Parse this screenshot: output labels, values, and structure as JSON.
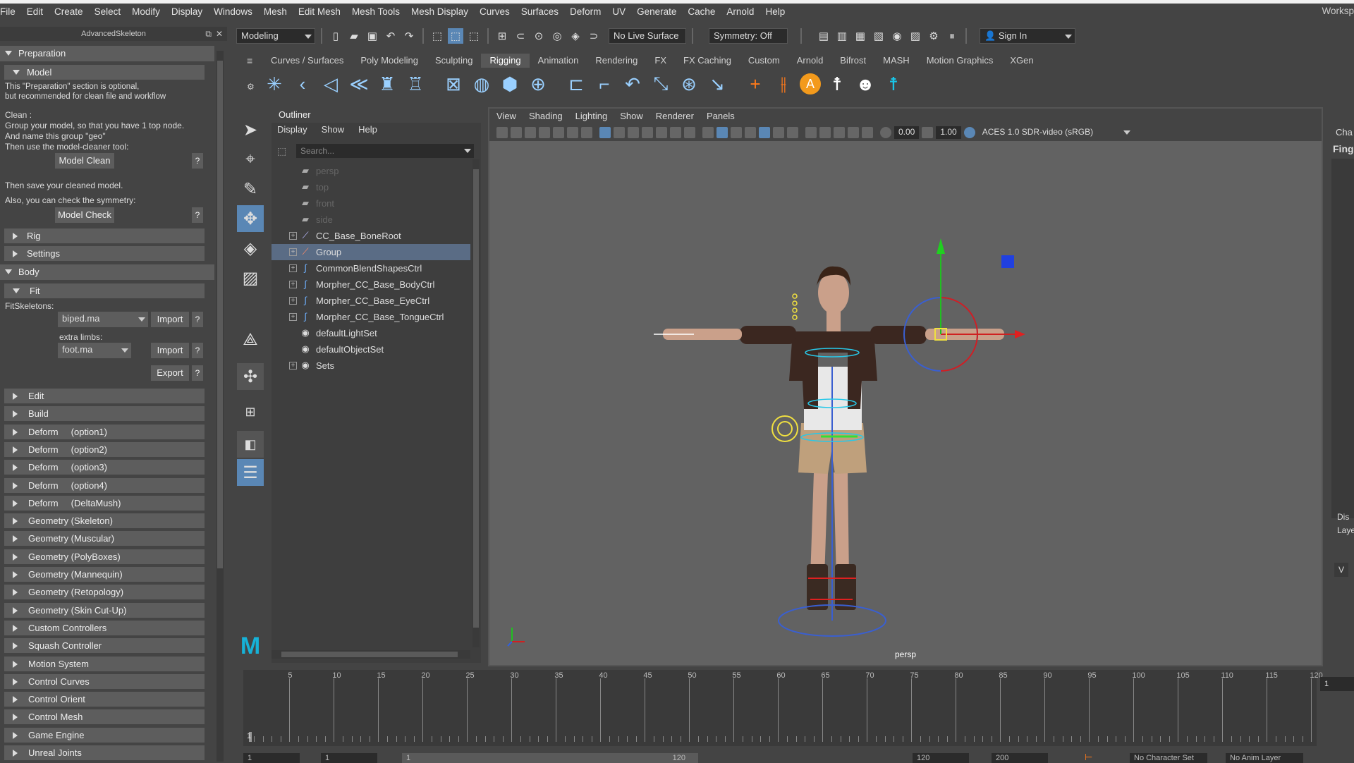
{
  "menu": [
    "File",
    "Edit",
    "Create",
    "Select",
    "Modify",
    "Display",
    "Windows",
    "Mesh",
    "Edit Mesh",
    "Mesh Tools",
    "Mesh Display",
    "Curves",
    "Surfaces",
    "Deform",
    "UV",
    "Generate",
    "Cache",
    "Arnold",
    "Help"
  ],
  "workspace_label": "Worksp",
  "status": {
    "mode": "Modeling",
    "live_surface": "No Live Surface",
    "symmetry": "Symmetry: Off",
    "sign_in": "Sign In"
  },
  "shelf_tabs": [
    "Curves / Surfaces",
    "Poly Modeling",
    "Sculpting",
    "Rigging",
    "Animation",
    "Rendering",
    "FX",
    "FX Caching",
    "Custom",
    "Arnold",
    "Bifrost",
    "MASH",
    "Motion Graphics",
    "XGen"
  ],
  "shelf_active": "Rigging",
  "as": {
    "title": "AdvancedSkeleton",
    "preparation": "Preparation",
    "model": "Model",
    "note1": "This \"Preparation\" section is optional,",
    "note2": "but recommended for clean file and workflow",
    "clean": "Clean :",
    "clean1": "Group your model, so that you have 1 top node.",
    "clean2": "And name this group \"geo\"",
    "clean3": "Then use the model-cleaner tool:",
    "model_clean": "Model Clean",
    "save_text": "Then save your cleaned model.",
    "sym_text": "Also, you can check the symmetry:",
    "model_check": "Model Check",
    "qmark": "?",
    "rig": "Rig",
    "settings": "Settings",
    "body": "Body",
    "fit": "Fit",
    "fitskel": "FitSkeletons:",
    "biped": "biped.ma",
    "import": "Import",
    "extra": "extra limbs:",
    "foot": "foot.ma",
    "export": "Export",
    "sections": [
      "Edit",
      "Build",
      "Deform     (option1)",
      "Deform     (option2)",
      "Deform     (option3)",
      "Deform     (option4)",
      "Deform     (DeltaMush)",
      "Geometry (Skeleton)",
      "Geometry (Muscular)",
      "Geometry (PolyBoxes)",
      "Geometry (Mannequin)",
      "Geometry (Retopology)",
      "Geometry (Skin Cut-Up)",
      "Custom Controllers",
      "Squash Controller",
      "Motion System",
      "Control Curves",
      "Control Orient",
      "Control Mesh",
      "Game Engine",
      "Unreal Joints"
    ]
  },
  "outliner": {
    "title": "Outliner",
    "menu": [
      "Display",
      "Show",
      "Help"
    ],
    "search": "Search...",
    "items": [
      {
        "label": "persp",
        "dim": true,
        "icon": "camera-icon",
        "expand": false
      },
      {
        "label": "top",
        "dim": true,
        "icon": "camera-icon",
        "expand": false
      },
      {
        "label": "front",
        "dim": true,
        "icon": "camera-icon",
        "expand": false
      },
      {
        "label": "side",
        "dim": true,
        "icon": "camera-icon",
        "expand": false
      },
      {
        "label": "CC_Base_BoneRoot",
        "dim": false,
        "icon": "joint-icon",
        "expand": true
      },
      {
        "label": "Group",
        "dim": false,
        "icon": "group-icon",
        "expand": true,
        "sel": true
      },
      {
        "label": "CommonBlendShapesCtrl",
        "dim": false,
        "icon": "curve-icon",
        "expand": true
      },
      {
        "label": "Morpher_CC_Base_BodyCtrl",
        "dim": false,
        "icon": "curve-icon",
        "expand": true
      },
      {
        "label": "Morpher_CC_Base_EyeCtrl",
        "dim": false,
        "icon": "curve-icon",
        "expand": true
      },
      {
        "label": "Morpher_CC_Base_TongueCtrl",
        "dim": false,
        "icon": "curve-icon",
        "expand": true
      },
      {
        "label": "defaultLightSet",
        "dim": false,
        "icon": "set-icon",
        "expand": false
      },
      {
        "label": "defaultObjectSet",
        "dim": false,
        "icon": "set-icon",
        "expand": false
      },
      {
        "label": "Sets",
        "dim": false,
        "icon": "set-icon",
        "expand": true
      }
    ]
  },
  "viewport": {
    "menu": [
      "View",
      "Shading",
      "Lighting",
      "Show",
      "Renderer",
      "Panels"
    ],
    "val1": "0.00",
    "val2": "1.00",
    "colorspace": "ACES 1.0 SDR-video (sRGB)",
    "camera": "persp"
  },
  "right": {
    "cha": "Cha",
    "fing": "Finge",
    "dis": "Dis",
    "lay": "Laye",
    "v": "V",
    "one": "1"
  },
  "timeline": {
    "ticks": [
      "5",
      "10",
      "15",
      "20",
      "25",
      "30",
      "35",
      "40",
      "45",
      "50",
      "55",
      "60",
      "65",
      "70",
      "75",
      "80",
      "85",
      "90",
      "95",
      "100",
      "105",
      "110",
      "115",
      "120"
    ],
    "current": "1"
  },
  "bottom": {
    "start": "1",
    "start2": "1",
    "range_end": "120",
    "end": "120",
    "end2": "200",
    "charset": "No Character Set",
    "animlayer": "No Anim Layer"
  }
}
